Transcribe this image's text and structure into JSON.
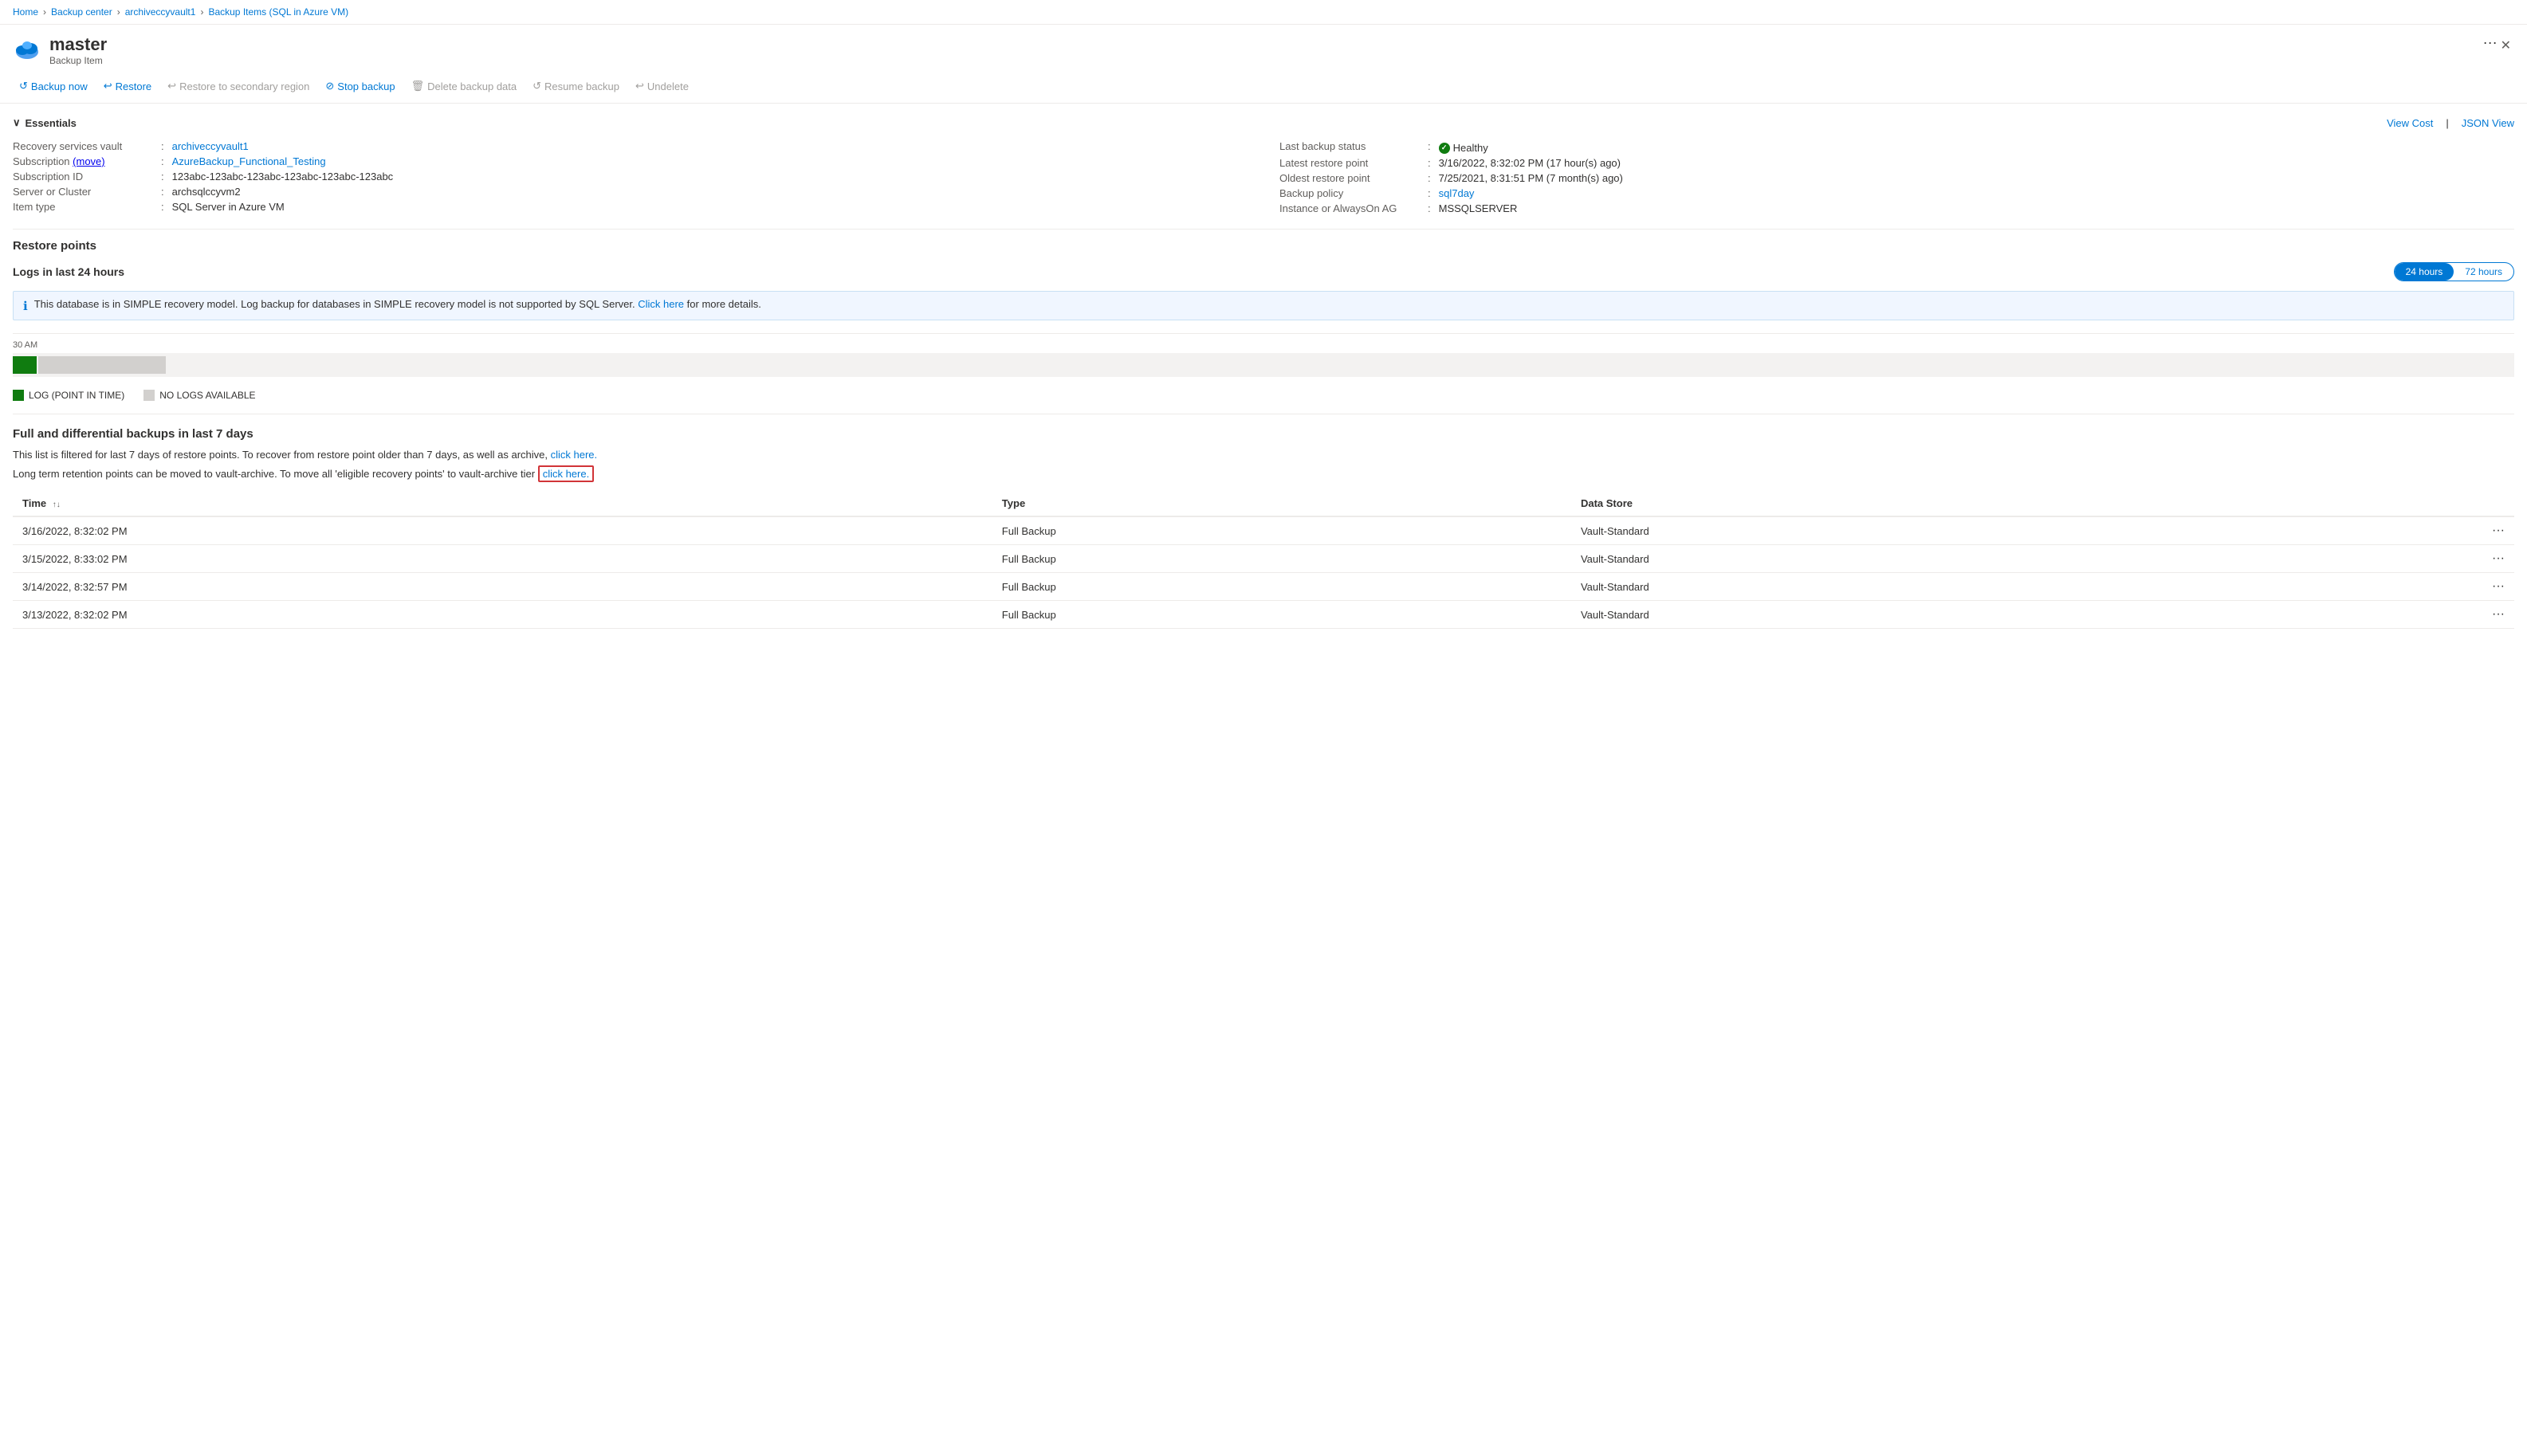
{
  "breadcrumb": {
    "items": [
      {
        "label": "Home",
        "href": "#"
      },
      {
        "label": "Backup center",
        "href": "#"
      },
      {
        "label": "archiveccyvault1",
        "href": "#"
      },
      {
        "label": "Backup Items (SQL in Azure VM)",
        "href": "#"
      }
    ]
  },
  "header": {
    "title": "master",
    "subtitle": "Backup Item",
    "menu_label": "···",
    "close_label": "✕"
  },
  "toolbar": {
    "backup_now": "Backup now",
    "restore": "Restore",
    "restore_secondary": "Restore to secondary region",
    "stop_backup": "Stop backup",
    "delete_backup": "Delete backup data",
    "resume_backup": "Resume backup",
    "undelete": "Undelete"
  },
  "essentials": {
    "title": "Essentials",
    "view_cost": "View Cost",
    "json_view": "JSON View",
    "left_rows": [
      {
        "label": "Recovery services vault",
        "value": "archiveccyvault1",
        "link": true
      },
      {
        "label": "Subscription",
        "value": "AzureBackup_Functional_Testing",
        "link": true,
        "prefix": "(move)"
      },
      {
        "label": "Subscription ID",
        "value": "123abc-123abc-123abc-123abc-123abc-123abc",
        "link": false
      },
      {
        "label": "Server or Cluster",
        "value": "archsqlccyvm2",
        "link": false
      },
      {
        "label": "Item type",
        "value": "SQL Server in Azure VM",
        "link": false
      }
    ],
    "right_rows": [
      {
        "label": "Last backup status",
        "value": "Healthy",
        "status": true
      },
      {
        "label": "Latest restore point",
        "value": "3/16/2022, 8:32:02 PM (17 hour(s) ago)",
        "link": false
      },
      {
        "label": "Oldest restore point",
        "value": "7/25/2021, 8:31:51 PM (7 month(s) ago)",
        "link": false
      },
      {
        "label": "Backup policy",
        "value": "sql7day",
        "link": true
      },
      {
        "label": "Instance or AlwaysOn AG",
        "value": "MSSQLSERVER",
        "link": false
      }
    ]
  },
  "restore_points": {
    "title": "Restore points",
    "logs_title": "Logs in last 24 hours",
    "toggle_24": "24 hours",
    "toggle_72": "72 hours",
    "info_text": "This database is in SIMPLE recovery model. Log backup for databases in SIMPLE recovery model is not supported by SQL Server.",
    "info_link_text": "Click here",
    "info_link_suffix": " for more details.",
    "timeline_label": "30 AM",
    "legend": [
      {
        "label": "LOG (POINT IN TIME)",
        "color": "green"
      },
      {
        "label": "NO LOGS AVAILABLE",
        "color": "gray"
      }
    ]
  },
  "full_differential": {
    "title": "Full and differential backups in last 7 days",
    "desc1": "This list is filtered for last 7 days of restore points. To recover from restore point older than 7 days, as well as archive,",
    "desc1_link": "click here.",
    "desc2": "Long term retention points can be moved to vault-archive. To move all 'eligible recovery points' to vault-archive tier",
    "desc2_link": "click here.",
    "table": {
      "columns": [
        {
          "label": "Time",
          "sort": true
        },
        {
          "label": "Type",
          "sort": false
        },
        {
          "label": "Data Store",
          "sort": false
        }
      ],
      "rows": [
        {
          "time": "3/16/2022, 8:32:02 PM",
          "type": "Full Backup",
          "datastore": "Vault-Standard"
        },
        {
          "time": "3/15/2022, 8:33:02 PM",
          "type": "Full Backup",
          "datastore": "Vault-Standard"
        },
        {
          "time": "3/14/2022, 8:32:57 PM",
          "type": "Full Backup",
          "datastore": "Vault-Standard"
        },
        {
          "time": "3/13/2022, 8:32:02 PM",
          "type": "Full Backup",
          "datastore": "Vault-Standard"
        }
      ]
    }
  }
}
